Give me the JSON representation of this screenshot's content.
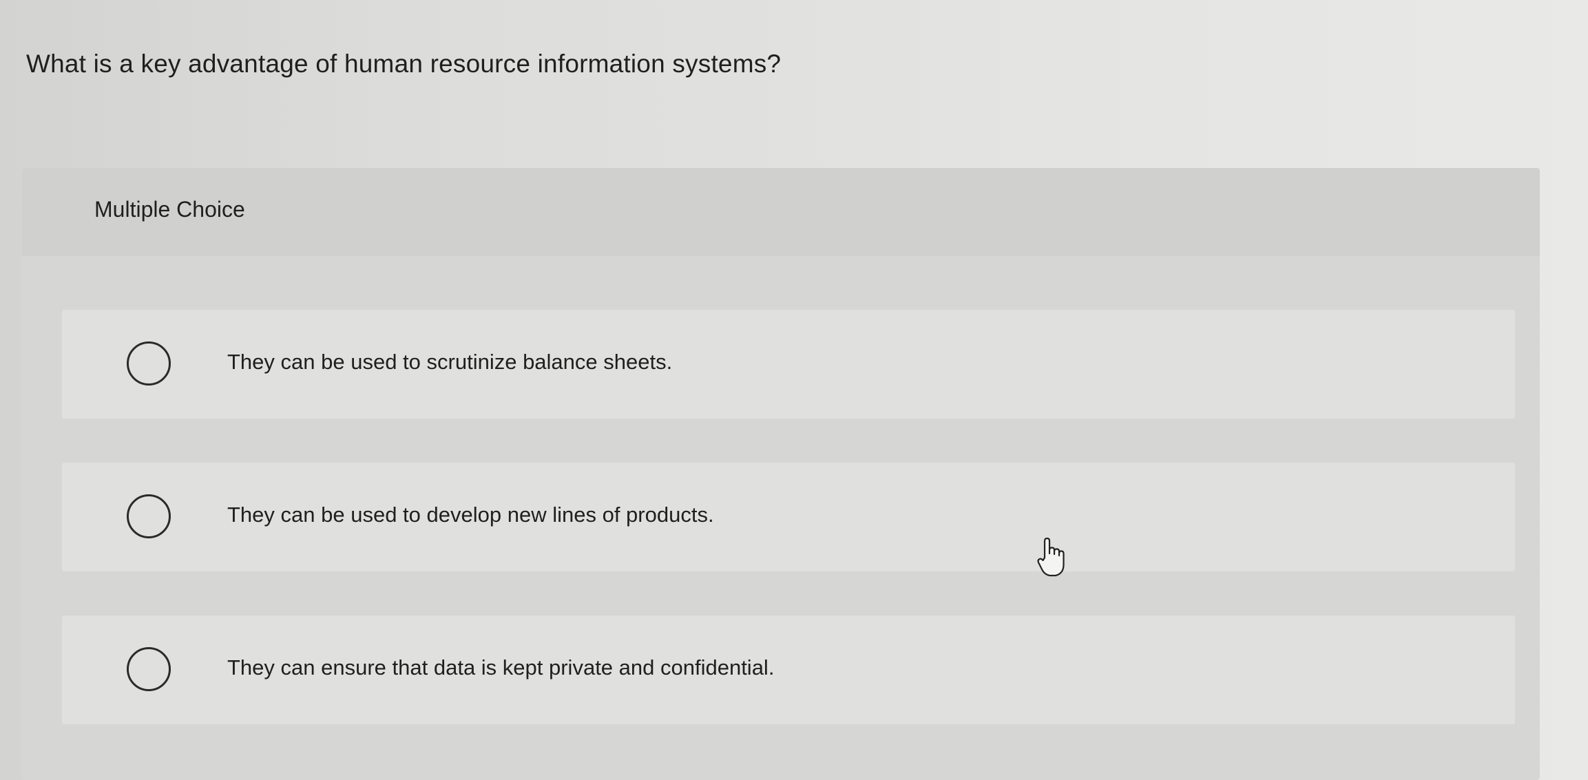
{
  "question": {
    "text": "What is a key advantage of human resource information systems?"
  },
  "choice_panel": {
    "type_label": "Multiple Choice",
    "options": [
      {
        "label": "They can be used to scrutinize balance sheets.",
        "selected": false
      },
      {
        "label": "They can be used to develop new lines of products.",
        "selected": false
      },
      {
        "label": "They can ensure that data is kept private and confidential.",
        "selected": false
      }
    ]
  },
  "cursor": {
    "icon": "hand-pointer-icon"
  }
}
